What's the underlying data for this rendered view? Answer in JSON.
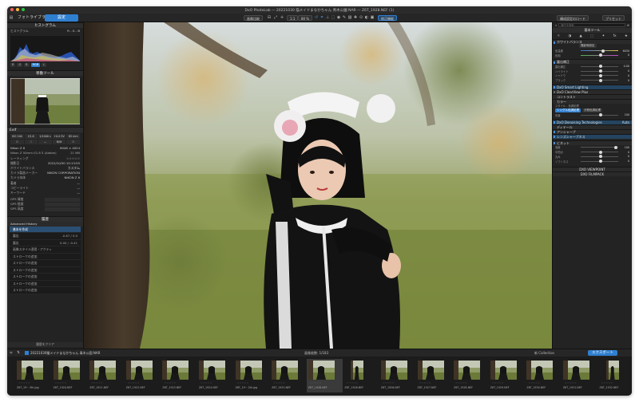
{
  "window": {
    "title": "DxO PhotoLab — 20221030 猫メイドまなかちゃん 青木公園 NAR — Z6T_1928.NEF (1)"
  },
  "toolbar": {
    "tab_library": "フォトライブラリ",
    "tab_customize": "設定",
    "compare_label": "画像比較",
    "zoom_value": "1:1",
    "zoom_percent": "80 %",
    "repair_label": "修正機能",
    "workspace_label": "構成設定のロード",
    "preset_label": "プリセット"
  },
  "left": {
    "histogram": {
      "title": "ヒストグラム",
      "sub": "ヒストグラム",
      "channels": "R - G - B",
      "buttons": [
        "R",
        "G",
        "B",
        "RGB",
        "L"
      ]
    },
    "navigator": {
      "title": "移動ツール"
    },
    "exif": {
      "title": "Exif",
      "chips": [
        "ISO 100",
        "f/1.8",
        "1/1000 s",
        "+0.0 EV",
        "85 mm"
      ],
      "chips2": [
        "☐",
        "⛶",
        "—",
        "B/W",
        "☐"
      ],
      "camera": "Nikon Z 6",
      "dims": "6048 × 4024",
      "lens": "Nikon Z 50mm f/1.8 S (Adobe)",
      "size": "21 MB",
      "rows": [
        {
          "label": "レーティング",
          "value": "☆☆☆☆☆"
        },
        {
          "label": "撮影日",
          "value": "2022/10/30 10:13:55"
        },
        {
          "label": "ホワイトバランス",
          "value": "カスタム"
        },
        {
          "label": "カメラ製造メーカー",
          "value": "NIKON CORPORATION"
        },
        {
          "label": "カメラ本体",
          "value": "NIKON Z 6"
        },
        {
          "label": "著者",
          "value": "—"
        },
        {
          "label": "コピーライト",
          "value": "—"
        },
        {
          "label": "キーワード",
          "value": "—"
        },
        {
          "label": "GPS 緯度",
          "value": ""
        },
        {
          "label": "GPS 経度",
          "value": ""
        },
        {
          "label": "GPS 高度",
          "value": ""
        }
      ]
    },
    "history": {
      "title": "履歴",
      "sub": "Advanced History",
      "items": [
        {
          "label": "基本を作成",
          "value": ""
        },
        {
          "label": "露出",
          "value": "-0.67 / 0.0"
        },
        {
          "label": "露出",
          "value": "0.00 / -0.41"
        },
        {
          "label": "画像スタイル適用・アクティ",
          "value": ""
        },
        {
          "label": "ストロークの追加",
          "value": ""
        },
        {
          "label": "ストロークの追加",
          "value": ""
        },
        {
          "label": "ストロークの追加",
          "value": ""
        },
        {
          "label": "ストロークの追加",
          "value": ""
        },
        {
          "label": "ストロークの追加",
          "value": ""
        },
        {
          "label": "ストロークの追加",
          "value": ""
        }
      ],
      "footer": "履歴をクリア"
    }
  },
  "right": {
    "search_placeholder": "補正を検索",
    "panel_title": "基本ツール",
    "sections": {
      "white_balance": "ホワイトバランス",
      "wb_mode": "撮影時設定",
      "color_temp": {
        "label": "色温度",
        "value": "6030"
      },
      "tint": {
        "label": "色相",
        "value": "0"
      },
      "exposure": "露出補正",
      "exposure_rows": [
        {
          "label": "露出補正",
          "value": "0.00"
        },
        {
          "label": "ハイライト",
          "value": "0"
        },
        {
          "label": "シャドウ",
          "value": "0"
        },
        {
          "label": "ブラック",
          "value": "0"
        }
      ],
      "smart_lighting": "DxO Smart Lighting",
      "clearview": "DxO ClearView Plus",
      "vibrancy": "コントラスト",
      "micro": "カラー",
      "style": "スタイル - 色調処理",
      "style_btn_1": "シングル色調処理",
      "style_btn_2": "分割色調処理",
      "saturation": {
        "label": "彩度",
        "value": "100"
      },
      "denoise": "DxO Denoising Technologies",
      "denoise_value": "Auto",
      "details": "ディテール",
      "sharpen": "アンシャープ",
      "lens": "レンズシャープネス",
      "vignette": "ビネット",
      "vignette_rows": [
        {
          "label": "強度",
          "value": "100"
        },
        {
          "label": "中間点",
          "value": "0"
        },
        {
          "label": "丸み",
          "value": "0"
        },
        {
          "label": "ソフトネス",
          "value": "0"
        }
      ],
      "viewpoint": "DXO VIEWPOINT",
      "filmpack": "DXO FILMPACK"
    }
  },
  "strip_bar": {
    "folder": "20221030猫メイドまなかちゃん 青木公園 NAR",
    "count": "画像枚数: 1/183",
    "project_label": "新 Collection",
    "export_label": "エクスポート"
  },
  "thumbs": [
    {
      "name": "Z6T_19~.3th.jpg",
      "portrait": false
    },
    {
      "name": "Z6T_1920.NEF",
      "portrait": false
    },
    {
      "name": "Z6T_1921.NEF",
      "portrait": false
    },
    {
      "name": "Z6T_1922.NEF",
      "portrait": false
    },
    {
      "name": "Z6T_1923.NEF",
      "portrait": false
    },
    {
      "name": "Z6T_1924.NEF",
      "portrait": false
    },
    {
      "name": "Z6T_19~.2th.jpg",
      "portrait": false
    },
    {
      "name": "Z6T_1925.NEF",
      "portrait": false
    },
    {
      "name": "Z6T_1928.NEF",
      "portrait": false,
      "selected": true
    },
    {
      "name": "Z6T_1926.NEF",
      "portrait": true
    },
    {
      "name": "Z6T_1926.NEF",
      "portrait": false
    },
    {
      "name": "Z6T_1927.NEF",
      "portrait": false
    },
    {
      "name": "Z6T_1928.NEF",
      "portrait": false
    },
    {
      "name": "Z6T_1929.NEF",
      "portrait": false
    },
    {
      "name": "Z6T_1930.NEF",
      "portrait": false
    },
    {
      "name": "Z6T_1931.NEF",
      "portrait": false
    },
    {
      "name": "Z6T_1932.NEF",
      "portrait": true
    }
  ],
  "colors": {
    "accent": "#2f7fd0",
    "panel": "#232323",
    "window": "#1f1f1f"
  }
}
